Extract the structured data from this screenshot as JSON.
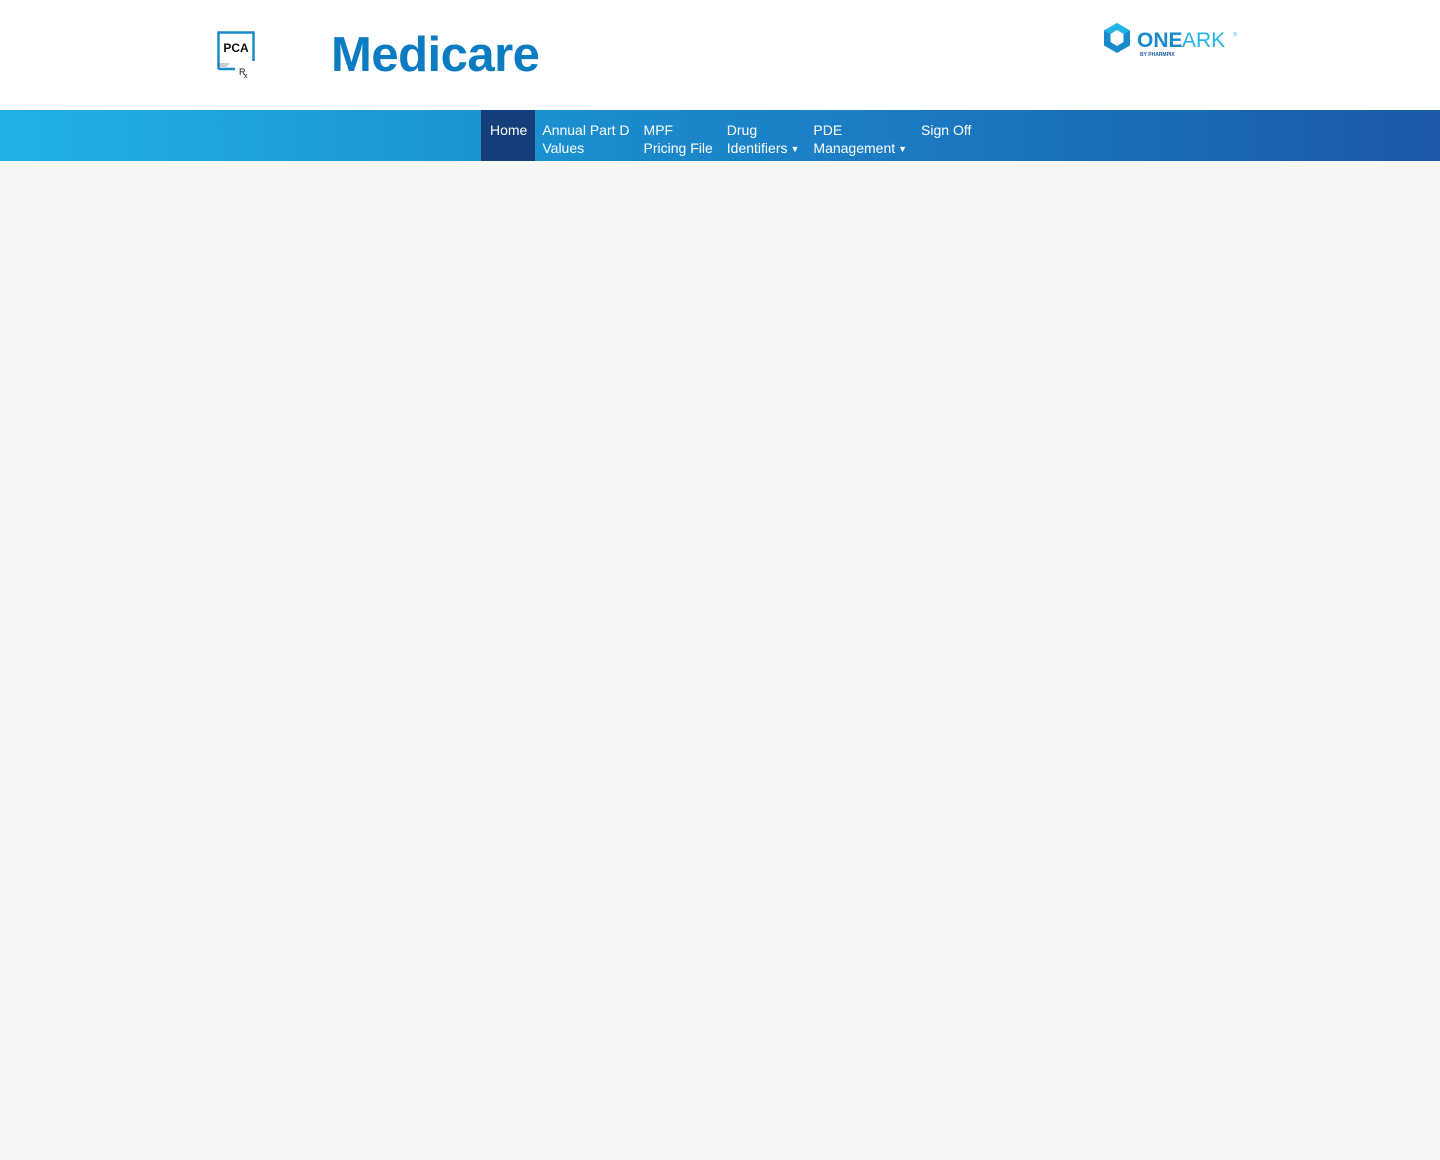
{
  "header": {
    "logo_left": {
      "name": "PCA Rx logo",
      "text": "PCA",
      "rx": "Rx"
    },
    "title": "Medicare",
    "logo_right": {
      "name": "OneArk logo",
      "one": "ONE",
      "ark": "ARK",
      "byline": "BY PHARMPIX"
    }
  },
  "nav": {
    "items": [
      {
        "line1": "Home",
        "line2": "",
        "dropdown": false,
        "active": true
      },
      {
        "line1": "Annual Part D",
        "line2": "Values",
        "dropdown": false,
        "active": false
      },
      {
        "line1": "MPF",
        "line2": "Pricing File",
        "dropdown": false,
        "active": false
      },
      {
        "line1": "Drug",
        "line2": "Identifiers",
        "dropdown": true,
        "active": false
      },
      {
        "line1": "PDE",
        "line2": "Management",
        "dropdown": true,
        "active": false
      },
      {
        "line1": "Sign Off",
        "line2": "",
        "dropdown": false,
        "active": false
      }
    ],
    "caret_icon": "caret-down-icon"
  },
  "colors": {
    "title": "#0b7cc1",
    "nav_gradient_start": "#21b1e6",
    "nav_gradient_end": "#1d59a7",
    "nav_active": "#143f7a",
    "page_background": "#f7f7f7"
  }
}
